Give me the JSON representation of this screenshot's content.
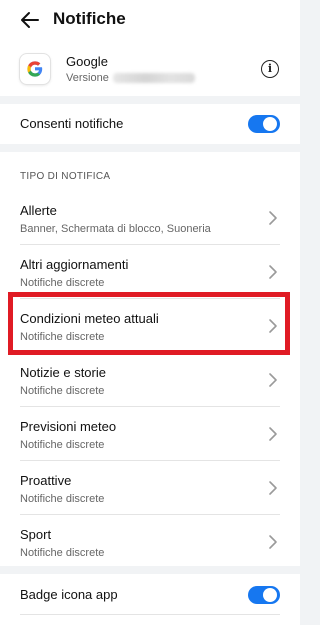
{
  "header": {
    "title": "Notifiche",
    "back_icon": "arrow-left-icon"
  },
  "app": {
    "name": "Google",
    "version_label": "Versione",
    "icon": "google-logo-icon"
  },
  "allow": {
    "label": "Consenti notifiche",
    "enabled": true
  },
  "section": {
    "title": "TIPO DI NOTIFICA"
  },
  "items": [
    {
      "title": "Allerte",
      "subtitle": "Banner, Schermata di blocco, Suoneria"
    },
    {
      "title": "Altri aggiornamenti",
      "subtitle": "Notifiche discrete"
    },
    {
      "title": "Condizioni meteo attuali",
      "subtitle": "Notifiche discrete",
      "highlighted": true
    },
    {
      "title": "Notizie e storie",
      "subtitle": "Notifiche discrete"
    },
    {
      "title": "Previsioni meteo",
      "subtitle": "Notifiche discrete"
    },
    {
      "title": "Proattive",
      "subtitle": "Notifiche discrete"
    },
    {
      "title": "Sport",
      "subtitle": "Notifiche discrete"
    }
  ],
  "badge": {
    "label": "Badge icona app",
    "enabled": true
  },
  "colors": {
    "accent": "#1677f0",
    "highlight": "#e01b24",
    "background": "#f1f3f5"
  }
}
